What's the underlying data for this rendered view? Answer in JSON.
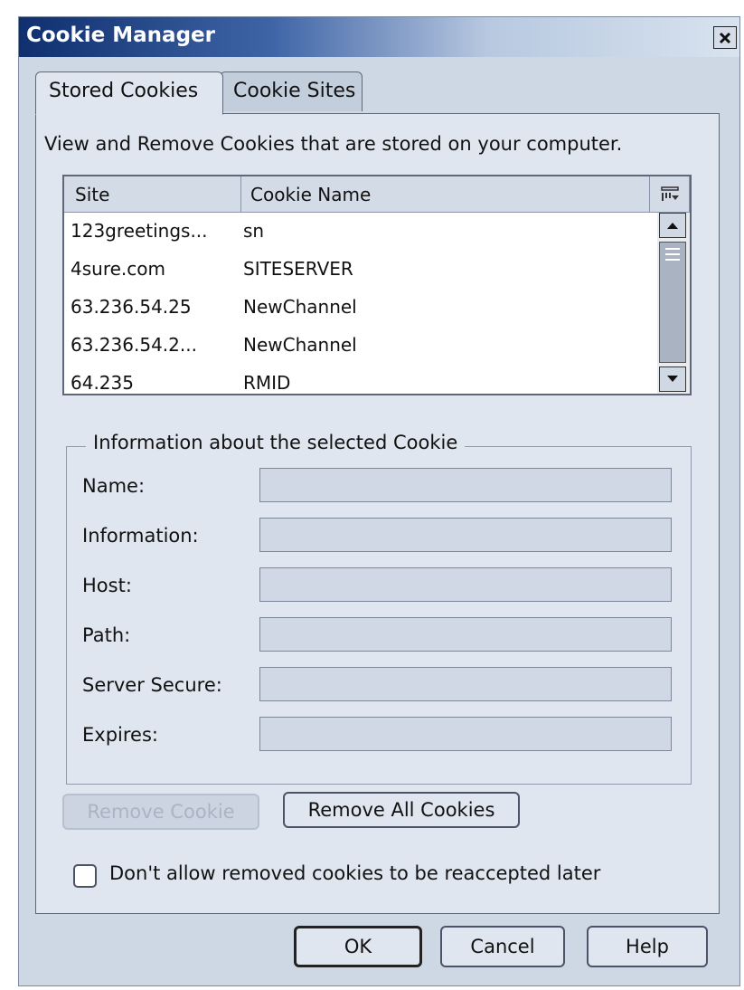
{
  "window": {
    "title": "Cookie Manager"
  },
  "tabs": [
    {
      "label": "Stored Cookies",
      "selected": true
    },
    {
      "label": "Cookie Sites",
      "selected": false
    }
  ],
  "intro_text": "View and Remove Cookies that are stored on your computer.",
  "cookie_list": {
    "columns": [
      "Site",
      "Cookie Name"
    ],
    "rows": [
      {
        "site": "123greetings...",
        "name": "sn"
      },
      {
        "site": "4sure.com",
        "name": "SITESERVER"
      },
      {
        "site": "63.236.54.25",
        "name": "NewChannel"
      },
      {
        "site": "63.236.54.2...",
        "name": "NewChannel"
      },
      {
        "site": "64.235",
        "name": "RMID"
      }
    ]
  },
  "info_group": {
    "legend": "Information about the selected Cookie",
    "fields": [
      {
        "label": "Name:",
        "value": ""
      },
      {
        "label": "Information:",
        "value": ""
      },
      {
        "label": "Host:",
        "value": ""
      },
      {
        "label": "Path:",
        "value": ""
      },
      {
        "label": "Server Secure:",
        "value": ""
      },
      {
        "label": "Expires:",
        "value": ""
      }
    ]
  },
  "actions": {
    "remove_cookie": "Remove Cookie",
    "remove_all": "Remove All Cookies"
  },
  "checkbox": {
    "label": "Don't allow removed cookies to be reaccepted later",
    "checked": false
  },
  "footer": {
    "ok": "OK",
    "cancel": "Cancel",
    "help": "Help"
  },
  "colors": {
    "titlebar_start": "#0f2f6e",
    "panel": "#dfe6ef",
    "window": "#ced8e4"
  }
}
